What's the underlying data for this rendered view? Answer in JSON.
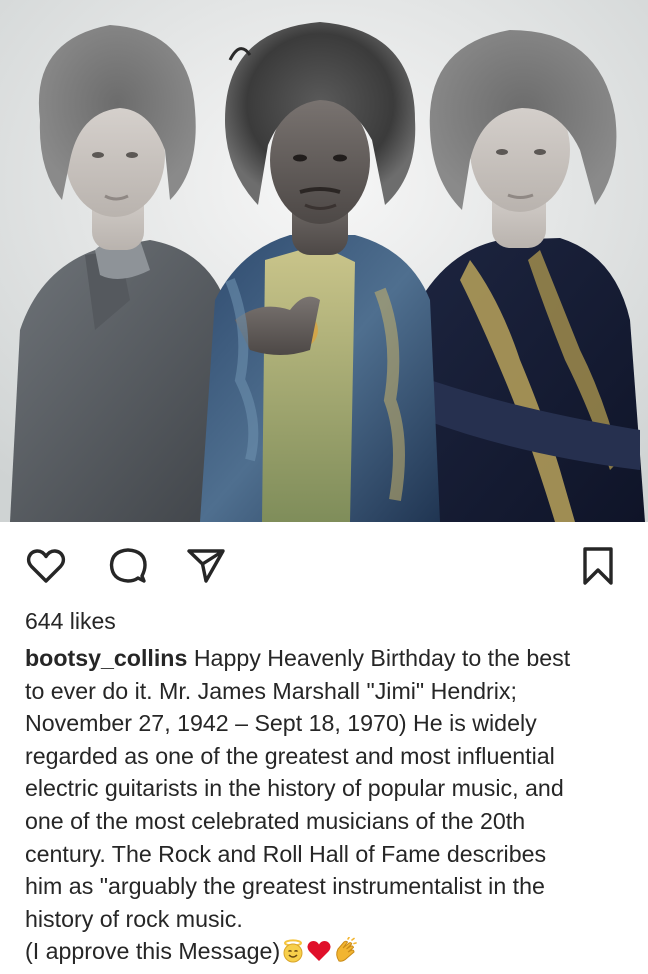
{
  "post": {
    "likes_text": "644 likes",
    "username": "bootsy_collins",
    "caption_lines": [
      "Happy Heavenly Birthday to the best",
      "to ever do it. Mr. James Marshall \"Jimi\" Hendrix;",
      "November 27, 1942 – Sept 18, 1970) He is widely",
      "regarded as one of the greatest and most influential",
      "electric guitarists in the history of popular music, and",
      "one of the most celebrated musicians of the 20th",
      "century. The Rock and Roll Hall of Fame describes",
      "him as \"arguably the greatest instrumentalist in the",
      "history of rock music.",
      "(I approve this Message)"
    ],
    "emojis": [
      "smiling-face-halo-icon",
      "red-heart-icon",
      "clapping-hands-icon"
    ]
  },
  "actions": {
    "like_icon": "heart-outline-icon",
    "comment_icon": "comment-bubble-icon",
    "share_icon": "paper-plane-icon",
    "save_icon": "bookmark-outline-icon"
  },
  "colors": {
    "text": "#262626",
    "icon": "#262626",
    "heart_emoji": "#e0102a",
    "halo_emoji": "#f5c43c"
  }
}
